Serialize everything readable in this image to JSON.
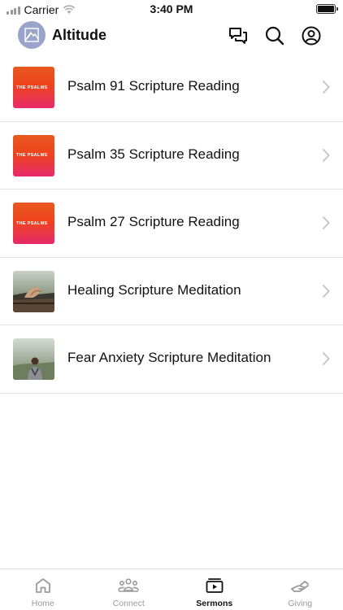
{
  "status_bar": {
    "carrier": "Carrier",
    "time": "3:40 PM"
  },
  "header": {
    "title": "Altitude",
    "icons": [
      "chat-icon",
      "search-icon",
      "account-icon"
    ]
  },
  "sermons": [
    {
      "title": "Psalm 91 Scripture Reading",
      "thumb": "the-psalms",
      "thumb_text": "THE PSALMS"
    },
    {
      "title": "Psalm 35 Scripture Reading",
      "thumb": "the-psalms",
      "thumb_text": "THE PSALMS"
    },
    {
      "title": "Psalm 27 Scripture Reading",
      "thumb": "the-psalms",
      "thumb_text": "THE PSALMS"
    },
    {
      "title": "Healing Scripture Meditation",
      "thumb": "photo-hands"
    },
    {
      "title": "Fear Anxiety Scripture Meditation",
      "thumb": "photo-man"
    }
  ],
  "tabs": [
    {
      "label": "Home",
      "icon": "home-icon",
      "active": false
    },
    {
      "label": "Connect",
      "icon": "people-icon",
      "active": false
    },
    {
      "label": "Sermons",
      "icon": "play-stack-icon",
      "active": true
    },
    {
      "label": "Giving",
      "icon": "giving-hand-icon",
      "active": false
    }
  ],
  "colors": {
    "accent": "#111111",
    "inactive": "#9a9a9a",
    "psalms_top": "#e85a1f",
    "psalms_bottom": "#e72a6a",
    "logo": "#9aa3c9"
  }
}
